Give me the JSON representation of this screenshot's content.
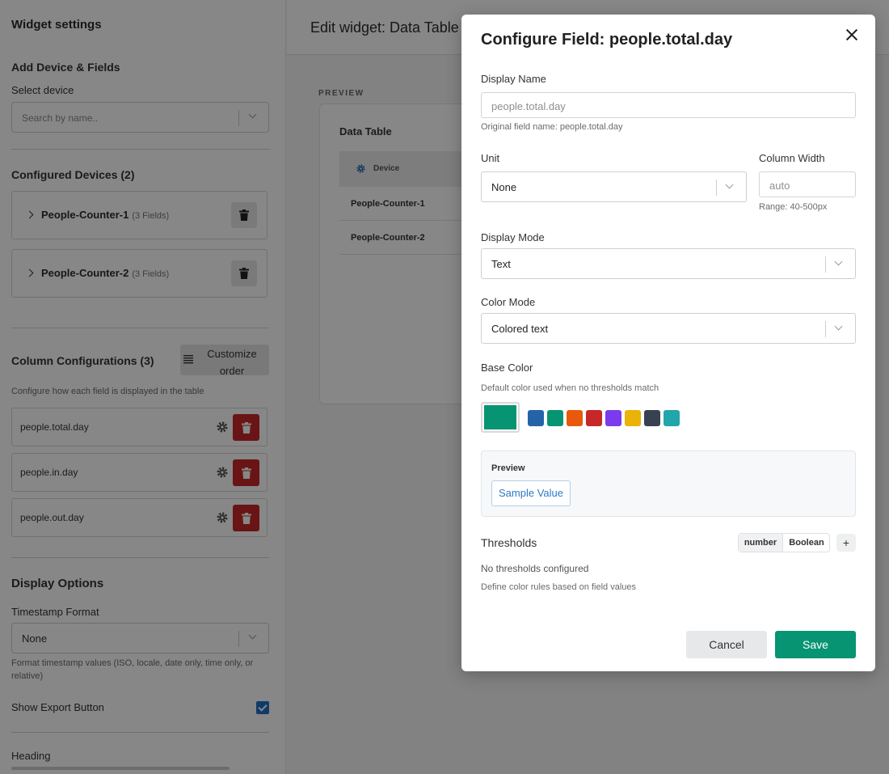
{
  "sidebar": {
    "title": "Widget settings",
    "add_section": {
      "heading": "Add Device & Fields",
      "select_label": "Select device",
      "search_placeholder": "Search by name.."
    },
    "configured": {
      "heading": "Configured Devices (2)",
      "devices": [
        {
          "name": "People-Counter-1",
          "count": "(3 Fields)"
        },
        {
          "name": "People-Counter-2",
          "count": "(3 Fields)"
        }
      ]
    },
    "columns": {
      "heading": "Column Configurations (3)",
      "customize_label": "Customize order",
      "help": "Configure how each field is displayed in the table",
      "fields": [
        "people.total.day",
        "people.in.day",
        "people.out.day"
      ]
    },
    "display_options": {
      "heading": "Display Options",
      "timestamp_label": "Timestamp Format",
      "timestamp_value": "None",
      "timestamp_help": "Format timestamp values (ISO, locale, date only, time only, or relative)",
      "export_label": "Show Export Button",
      "export_checked": true,
      "heading_label": "Heading"
    }
  },
  "main": {
    "title": "Edit widget: Data Table",
    "preview_label": "PREVIEW",
    "card_title": "Data Table",
    "column_header": "Device",
    "rows": [
      "People-Counter-1",
      "People-Counter-2"
    ]
  },
  "modal": {
    "title": "Configure Field: people.total.day",
    "display_name_label": "Display Name",
    "display_name_placeholder": "people.total.day",
    "original_name": "Original field name: people.total.day",
    "unit_label": "Unit",
    "unit_value": "None",
    "width_label": "Column Width",
    "width_placeholder": "auto",
    "width_help": "Range: 40-500px",
    "display_mode_label": "Display Mode",
    "display_mode_value": "Text",
    "color_mode_label": "Color Mode",
    "color_mode_value": "Colored text",
    "base_color_label": "Base Color",
    "base_color_help": "Default color used when no thresholds match",
    "base_color": "#069472",
    "swatches": [
      "#2563a8",
      "#069472",
      "#e8590c",
      "#c62828",
      "#7c3aed",
      "#eab308",
      "#374151",
      "#22a5ab"
    ],
    "preview_label": "Preview",
    "sample_value": "Sample Value",
    "thresholds_label": "Thresholds",
    "type_number": "number",
    "type_boolean": "Boolean",
    "add_label": "+",
    "no_thresholds": "No thresholds configured",
    "thresholds_help": "Define color rules based on field values",
    "cancel_label": "Cancel",
    "save_label": "Save"
  },
  "colors": {
    "accent": "#069472",
    "danger": "#c62828",
    "checkbox": "#1f6fc4"
  }
}
